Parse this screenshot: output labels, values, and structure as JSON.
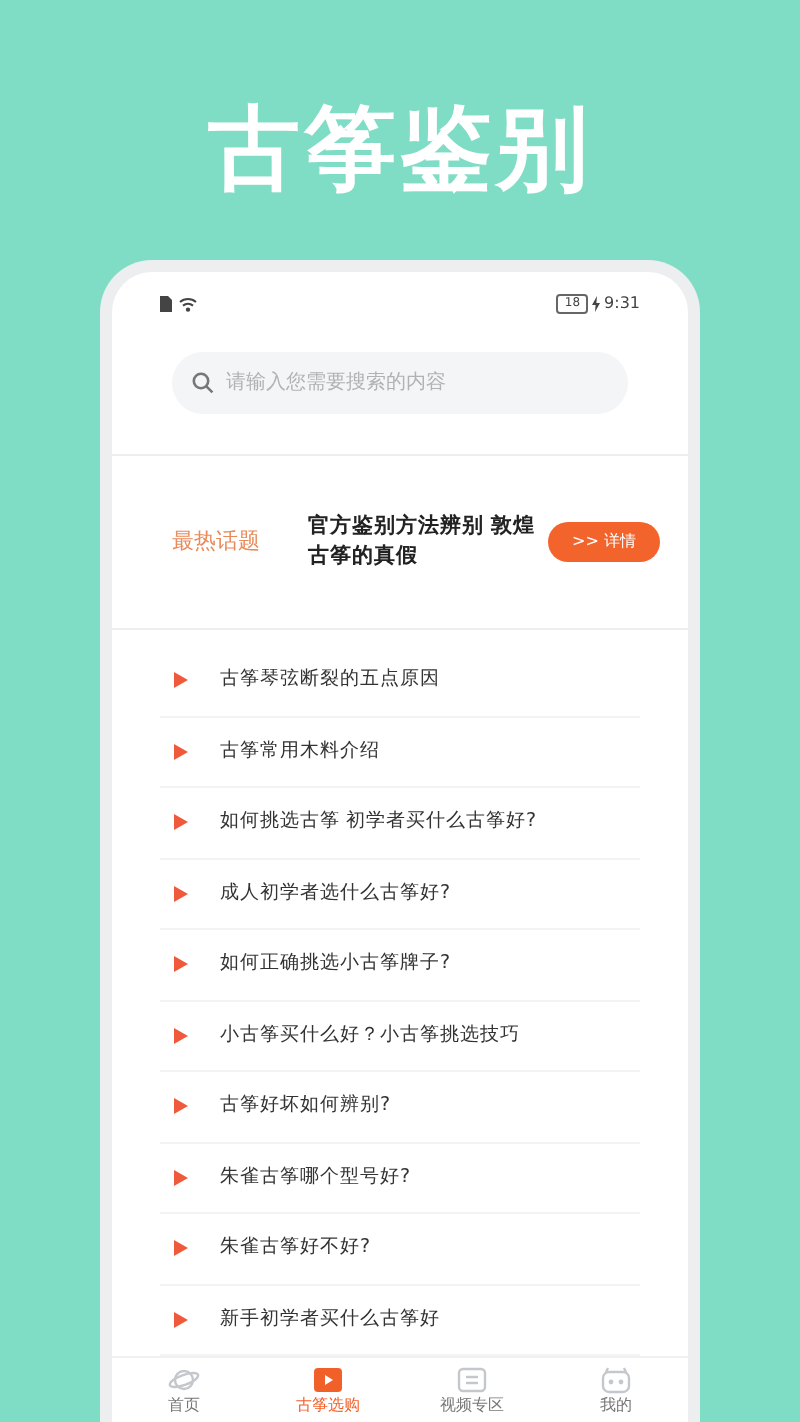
{
  "headline": "古筝鉴别",
  "status_bar": {
    "battery": "18",
    "time": "9:31"
  },
  "search": {
    "placeholder": "请输入您需要搜索的内容"
  },
  "hot_topic": {
    "label": "最热话题",
    "title": "官方鉴别方法辨别 敦煌古筝的真假",
    "button": ">> 详情"
  },
  "articles": [
    {
      "title": "古筝琴弦断裂的五点原因"
    },
    {
      "title": "古筝常用木料介绍"
    },
    {
      "title": "如何挑选古筝 初学者买什么古筝好?"
    },
    {
      "title": "成人初学者选什么古筝好?"
    },
    {
      "title": "如何正确挑选小古筝牌子?"
    },
    {
      "title": "小古筝买什么好？小古筝挑选技巧"
    },
    {
      "title": "古筝好坏如何辨别?"
    },
    {
      "title": "朱雀古筝哪个型号好?"
    },
    {
      "title": "朱雀古筝好不好?"
    },
    {
      "title": "新手初学者买什么古筝好"
    }
  ],
  "tab_bar": [
    {
      "label": "首页",
      "kind": "planet",
      "selected": false
    },
    {
      "label": "古筝选购",
      "kind": "play",
      "selected": true
    },
    {
      "label": "视频专区",
      "kind": "doc",
      "selected": false
    },
    {
      "label": "我的",
      "kind": "face",
      "selected": false
    }
  ]
}
